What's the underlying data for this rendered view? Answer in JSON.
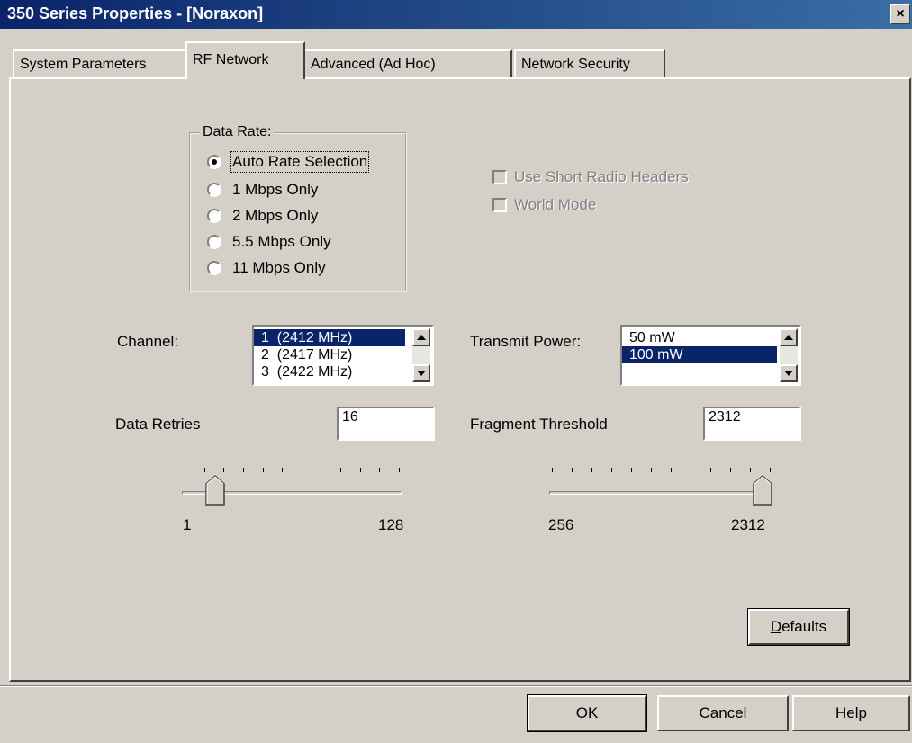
{
  "window": {
    "title": "350 Series Properties - [Noraxon]",
    "close_label": "×"
  },
  "tabs": [
    {
      "label": "System Parameters",
      "active": false
    },
    {
      "label": "RF Network",
      "active": true
    },
    {
      "label": "Advanced (Ad Hoc)",
      "active": false
    },
    {
      "label": "Network Security",
      "active": false
    }
  ],
  "data_rate": {
    "label": "Data Rate:",
    "options": [
      "Auto Rate Selection",
      "1 Mbps Only",
      "2 Mbps Only",
      "5.5 Mbps Only",
      "11 Mbps Only"
    ],
    "selected": "Auto Rate Selection"
  },
  "checkboxes": {
    "short_headers": {
      "label": "Use Short Radio Headers",
      "checked": false,
      "enabled": false
    },
    "world_mode": {
      "label": "World Mode",
      "checked": false,
      "enabled": false
    }
  },
  "channel": {
    "label": "Channel:",
    "items": [
      "1  (2412 MHz)",
      "2  (2417 MHz)",
      "3  (2422 MHz)"
    ],
    "selected": "1  (2412 MHz)"
  },
  "transmit_power": {
    "label": "Transmit Power:",
    "items": [
      "50 mW",
      "100 mW"
    ],
    "selected": "100 mW"
  },
  "data_retries": {
    "label": "Data Retries",
    "value": "16",
    "slider": {
      "min_label": "1",
      "max_label": "128",
      "min": 1,
      "max": 128,
      "value": 16
    }
  },
  "fragment_threshold": {
    "label": "Fragment Threshold",
    "value": "2312",
    "slider": {
      "min_label": "256",
      "max_label": "2312",
      "min": 256,
      "max": 2312,
      "value": 2312
    }
  },
  "buttons": {
    "defaults": "Defaults",
    "ok": "OK",
    "cancel": "Cancel",
    "help": "Help"
  },
  "colors": {
    "titlebar": "#0a246a",
    "face": "#d4d0c8",
    "selection": "#0a246a"
  }
}
